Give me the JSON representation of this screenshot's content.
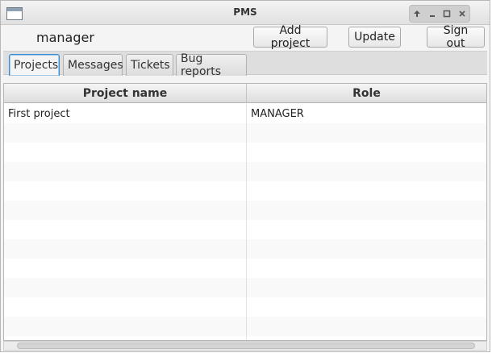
{
  "window": {
    "title": "PMS"
  },
  "toolbar": {
    "username": "manager",
    "add_project_label": "Add project",
    "update_label": "Update",
    "sign_out_label": "Sign out"
  },
  "tabs": [
    {
      "label": "Projects",
      "active": true
    },
    {
      "label": "Messages"
    },
    {
      "label": "Tickets"
    },
    {
      "label": "Bug reports"
    }
  ],
  "table": {
    "columns": [
      "Project name",
      "Role"
    ],
    "rows": [
      [
        "First project",
        "MANAGER"
      ]
    ]
  },
  "colors": {
    "active_tab_border": "#3a8ecf"
  }
}
